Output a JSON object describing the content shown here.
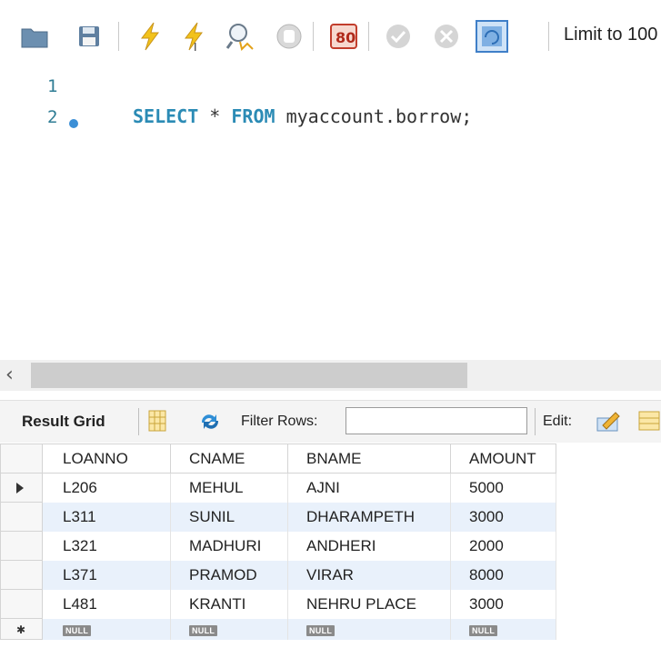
{
  "toolbar": {
    "limit_label": "Limit to 100",
    "icons": [
      "folder-icon",
      "save-icon",
      "execute-icon",
      "execute-current-icon",
      "explain-icon",
      "stop-icon",
      "toggle-output-icon",
      "commit-icon",
      "rollback-icon",
      "autocommit-icon"
    ]
  },
  "editor": {
    "line1": "1",
    "line2": "2",
    "code": {
      "kw1": "SELECT",
      "star": " * ",
      "kw2": "FROM",
      "rest": " myaccount.borrow;"
    }
  },
  "result": {
    "tab_label": "Result Grid",
    "filter_label": "Filter Rows:",
    "filter_value": "",
    "edit_label": "Edit:",
    "columns": [
      "LOANNO",
      "CNAME",
      "BNAME",
      "AMOUNT"
    ],
    "rows": [
      [
        "L206",
        "MEHUL",
        "AJNI",
        "5000"
      ],
      [
        "L311",
        "SUNIL",
        "DHARAMPETH",
        "3000"
      ],
      [
        "L321",
        "MADHURI",
        "ANDHERI",
        "2000"
      ],
      [
        "L371",
        "PRAMOD",
        "VIRAR",
        "8000"
      ],
      [
        "L481",
        "KRANTI",
        "NEHRU PLACE",
        "3000"
      ]
    ],
    "null_label": "NULL"
  }
}
